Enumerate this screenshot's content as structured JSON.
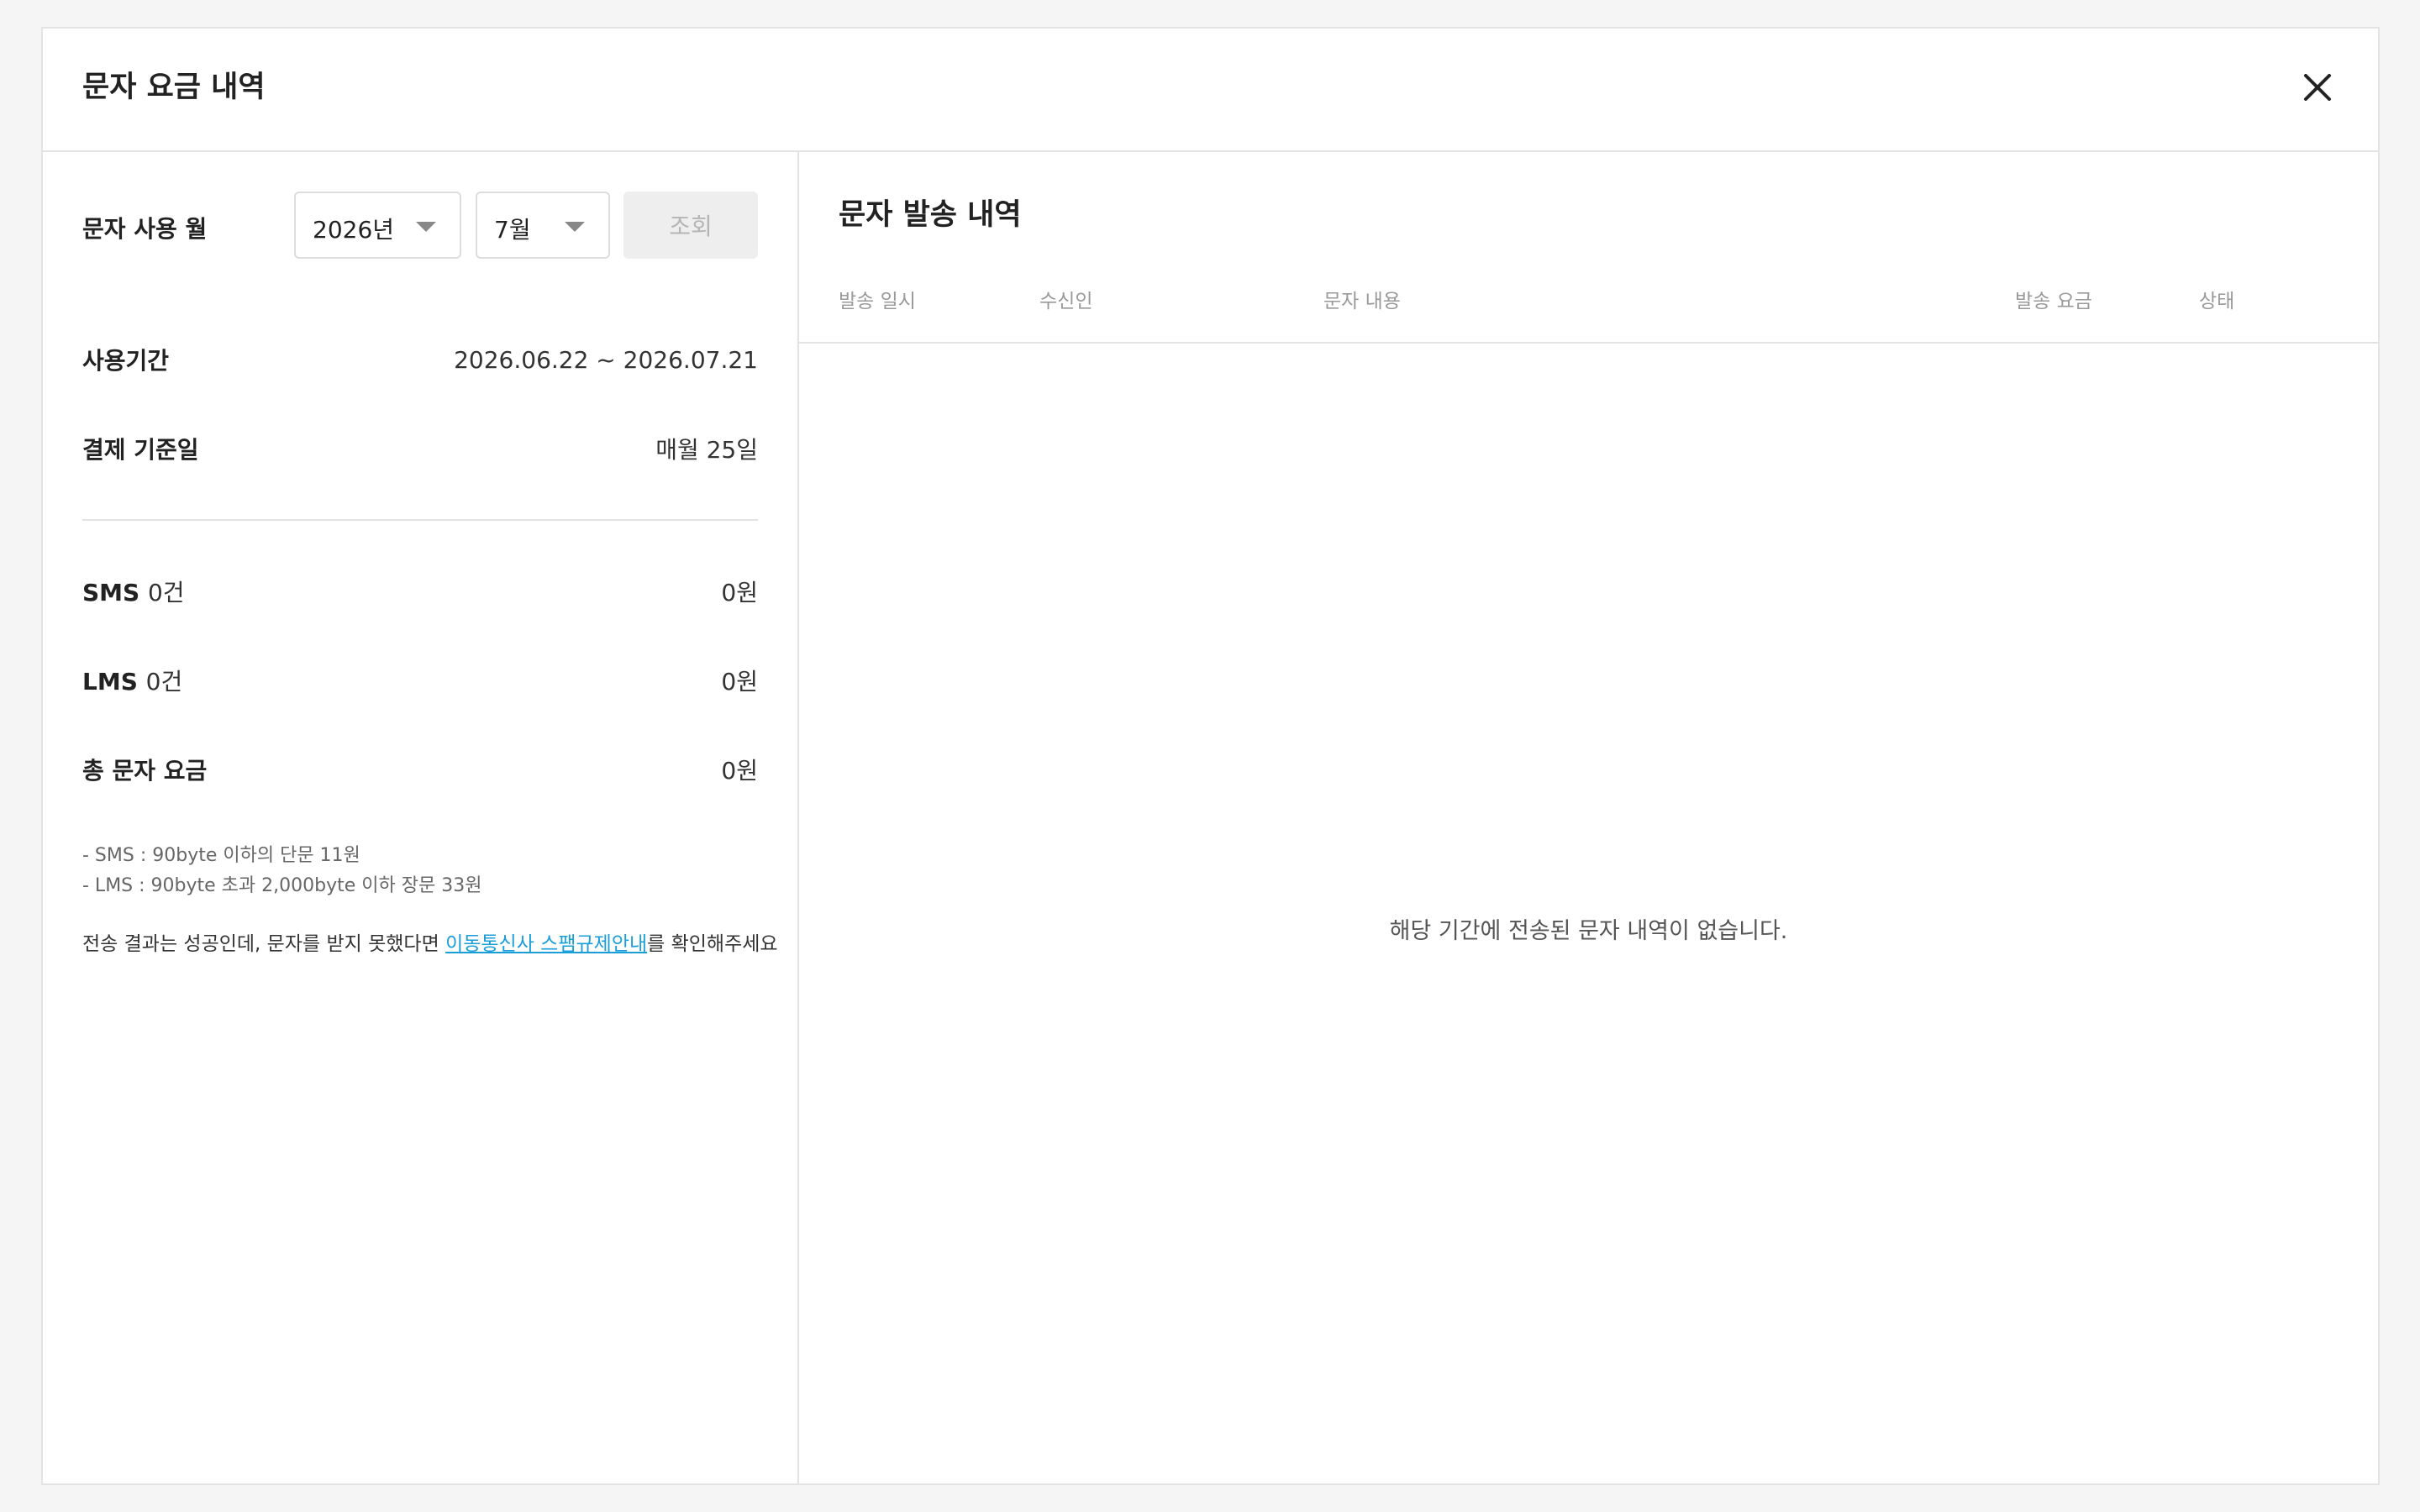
{
  "modal": {
    "title": "문자 요금 내역",
    "close_icon": "close-icon"
  },
  "filter": {
    "label": "문자 사용 월",
    "year": "2026년",
    "month": "7월",
    "query_label": "조회"
  },
  "summary": {
    "period_label": "사용기간",
    "period_value": "2026.06.22 ~ 2026.07.21",
    "billing_label": "결제 기준일",
    "billing_value": "매월 25일",
    "sms_label": "SMS",
    "sms_count": "0건",
    "sms_amount": "0원",
    "lms_label": "LMS",
    "lms_count": "0건",
    "lms_amount": "0원",
    "total_label": "총 문자 요금",
    "total_amount": "0원"
  },
  "notes": {
    "sms_note": "- SMS : 90byte 이하의 단문 11원",
    "lms_note": "- LMS : 90byte 초과 2,000byte 이하 장문 33원",
    "info_prefix": "전송 결과는 성공인데, 문자를 받지 못했다면 ",
    "info_link": "이동통신사 스팸규제안내",
    "info_suffix": "를 확인해주세요"
  },
  "history": {
    "title": "문자 발송 내역",
    "columns": [
      "발송 일시",
      "수신인",
      "문자 내용",
      "발송 요금",
      "상태"
    ],
    "empty_message": "해당 기간에 전송된 문자 내역이 없습니다."
  },
  "colors": {
    "link": "#1a9ed9",
    "border": "#e3e3e3",
    "background": "#f5f5f5"
  }
}
